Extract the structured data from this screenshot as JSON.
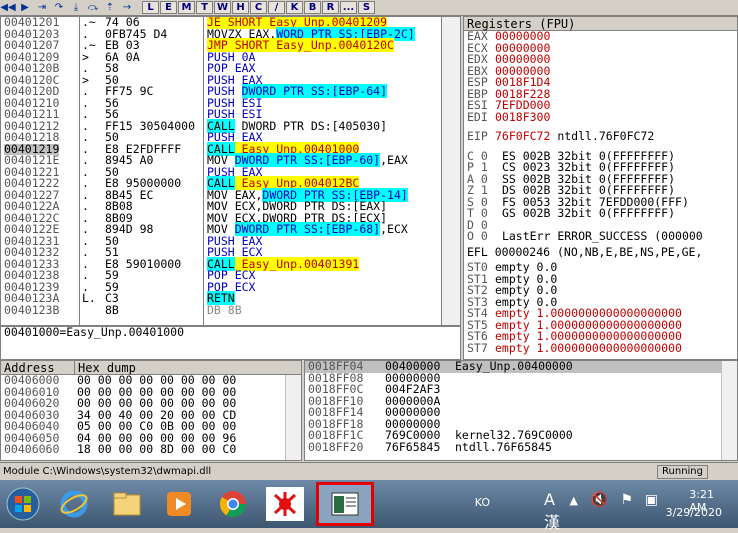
{
  "toolbar": {
    "letters": [
      "L",
      "E",
      "M",
      "T",
      "W",
      "H",
      "C",
      "/",
      "K",
      "B",
      "R",
      "...",
      "S"
    ],
    "icons": [
      "rewind-icon",
      "play-icon",
      "step-into-icon",
      "step-over-icon",
      "trace-into-icon",
      "trace-over-icon",
      "execute-till-return-icon",
      "goto-icon"
    ]
  },
  "cpu": {
    "rows": [
      {
        "addr": "00401201",
        "mark": ".~",
        "hex": "74 06",
        "dis": [
          {
            "t": "JE SHORT Easy_Unp.00401209",
            "c": "jmp"
          }
        ]
      },
      {
        "addr": "00401203",
        "mark": ".",
        "hex": "0FB745 D4",
        "dis": [
          {
            "t": "MOVZX EAX,",
            "c": ""
          },
          {
            "t": "WORD PTR SS:[EBP-2C]",
            "c": "mem"
          }
        ]
      },
      {
        "addr": "00401207",
        "mark": ".~",
        "hex": "EB 03",
        "dis": [
          {
            "t": "JMP SHORT Easy_Unp.0040120C",
            "c": "jmp"
          }
        ]
      },
      {
        "addr": "00401209",
        "mark": ">",
        "hex": "6A 0A",
        "dis": [
          {
            "t": "PUSH 0A",
            "c": "blue"
          }
        ]
      },
      {
        "addr": "0040120B",
        "mark": ".",
        "hex": "58",
        "dis": [
          {
            "t": "POP EAX",
            "c": "blue"
          }
        ]
      },
      {
        "addr": "0040120C",
        "mark": ">",
        "hex": "50",
        "dis": [
          {
            "t": "PUSH EAX",
            "c": "blue"
          }
        ]
      },
      {
        "addr": "0040120D",
        "mark": ".",
        "hex": "FF75 9C",
        "dis": [
          {
            "t": "PUSH ",
            "c": "blue"
          },
          {
            "t": "DWORD PTR SS:[EBP-64]",
            "c": "mem"
          }
        ]
      },
      {
        "addr": "00401210",
        "mark": ".",
        "hex": "56",
        "dis": [
          {
            "t": "PUSH ESI",
            "c": "blue"
          }
        ]
      },
      {
        "addr": "00401211",
        "mark": ".",
        "hex": "56",
        "dis": [
          {
            "t": "PUSH ESI",
            "c": "blue"
          }
        ]
      },
      {
        "addr": "00401212",
        "mark": ".",
        "hex": "FF15 30504000",
        "dis": [
          {
            "t": "CALL",
            "c": "call"
          },
          {
            "t": " DWORD PTR DS:[405030]",
            "c": ""
          }
        ]
      },
      {
        "addr": "00401218",
        "mark": ".",
        "hex": "50",
        "dis": [
          {
            "t": "PUSH EAX",
            "c": "blue"
          }
        ]
      },
      {
        "addr": "00401219",
        "mark": ".",
        "hex": "E8 E2FDFFFF",
        "dis": [
          {
            "t": "CALL",
            "c": "call"
          },
          {
            "t": " Easy_Unp.00401000",
            "c": "jmp"
          }
        ],
        "sel": true
      },
      {
        "addr": "0040121E",
        "mark": ".",
        "hex": "8945 A0",
        "dis": [
          {
            "t": "MOV ",
            "c": ""
          },
          {
            "t": "DWORD PTR SS:[EBP-60]",
            "c": "mem"
          },
          {
            "t": ",EAX",
            "c": ""
          }
        ]
      },
      {
        "addr": "00401221",
        "mark": ".",
        "hex": "50",
        "dis": [
          {
            "t": "PUSH EAX",
            "c": "blue"
          }
        ]
      },
      {
        "addr": "00401222",
        "mark": ".",
        "hex": "E8 95000000",
        "dis": [
          {
            "t": "CALL",
            "c": "call"
          },
          {
            "t": " Easy_Unp.004012BC",
            "c": "jmp"
          }
        ]
      },
      {
        "addr": "00401227",
        "mark": ".",
        "hex": "8B45 EC",
        "dis": [
          {
            "t": "MOV EAX,",
            "c": ""
          },
          {
            "t": "DWORD PTR SS:[EBP-14]",
            "c": "mem"
          }
        ]
      },
      {
        "addr": "0040122A",
        "mark": ".",
        "hex": "8B08",
        "dis": [
          {
            "t": "MOV ECX,DWORD PTR DS:[EAX]",
            "c": ""
          }
        ]
      },
      {
        "addr": "0040122C",
        "mark": ".",
        "hex": "8B09",
        "dis": [
          {
            "t": "MOV ECX,DWORD PTR DS:[ECX]",
            "c": ""
          }
        ]
      },
      {
        "addr": "0040122E",
        "mark": ".",
        "hex": "894D 98",
        "dis": [
          {
            "t": "MOV ",
            "c": ""
          },
          {
            "t": "DWORD PTR SS:[EBP-68]",
            "c": "mem"
          },
          {
            "t": ",ECX",
            "c": ""
          }
        ]
      },
      {
        "addr": "00401231",
        "mark": ".",
        "hex": "50",
        "dis": [
          {
            "t": "PUSH EAX",
            "c": "blue"
          }
        ]
      },
      {
        "addr": "00401232",
        "mark": ".",
        "hex": "51",
        "dis": [
          {
            "t": "PUSH ECX",
            "c": "blue"
          }
        ]
      },
      {
        "addr": "00401233",
        "mark": ".",
        "hex": "E8 59010000",
        "dis": [
          {
            "t": "CALL",
            "c": "call"
          },
          {
            "t": " Easy_Unp.00401391",
            "c": "jmp"
          }
        ]
      },
      {
        "addr": "00401238",
        "mark": ".",
        "hex": "59",
        "dis": [
          {
            "t": "POP ECX",
            "c": "blue"
          }
        ]
      },
      {
        "addr": "00401239",
        "mark": ".",
        "hex": "59",
        "dis": [
          {
            "t": "POP ECX",
            "c": "blue"
          }
        ]
      },
      {
        "addr": "0040123A",
        "mark": "L.",
        "hex": "C3",
        "dis": [
          {
            "t": "RETN",
            "c": "ret"
          }
        ]
      },
      {
        "addr": "0040123B",
        "mark": "",
        "hex": "8B",
        "dis": [
          {
            "t": "DB 8B",
            "c": "gray"
          }
        ]
      }
    ],
    "info": "00401000=Easy_Unp.00401000"
  },
  "registers": {
    "title": "Registers (FPU)",
    "gp": [
      [
        "EAX",
        "00000000"
      ],
      [
        "ECX",
        "00000000"
      ],
      [
        "EDX",
        "00000000"
      ],
      [
        "EBX",
        "00000000"
      ],
      [
        "ESP",
        "0018F1D4"
      ],
      [
        "EBP",
        "0018F228"
      ],
      [
        "ESI",
        "7EFDD000"
      ],
      [
        "EDI",
        "0018F300"
      ]
    ],
    "eip": [
      "EIP",
      "76F0FC72",
      "ntdll.76F0FC72"
    ],
    "flags": [
      [
        "C 0",
        "ES 002B 32bit 0(FFFFFFFF)"
      ],
      [
        "P 1",
        "CS 0023 32bit 0(FFFFFFFF)"
      ],
      [
        "A 0",
        "SS 002B 32bit 0(FFFFFFFF)"
      ],
      [
        "Z 1",
        "DS 002B 32bit 0(FFFFFFFF)"
      ],
      [
        "S 0",
        "FS 0053 32bit 7EFDD000(FFF)"
      ],
      [
        "T 0",
        "GS 002B 32bit 0(FFFFFFFF)"
      ],
      [
        "D 0",
        ""
      ],
      [
        "O 0",
        "LastErr ERROR_SUCCESS (000000"
      ]
    ],
    "efl": "EFL 00000246 (NO,NB,E,BE,NS,PE,GE,",
    "fpu": [
      [
        "ST0",
        "empty 0.0",
        false
      ],
      [
        "ST1",
        "empty 0.0",
        false
      ],
      [
        "ST2",
        "empty 0.0",
        false
      ],
      [
        "ST3",
        "empty 0.0",
        false
      ],
      [
        "ST4",
        "empty 1.0000000000000000000",
        true
      ],
      [
        "ST5",
        "empty 1.0000000000000000000",
        true
      ],
      [
        "ST6",
        "empty 1.0000000000000000000",
        true
      ],
      [
        "ST7",
        "empty 1.0000000000000000000",
        true
      ]
    ]
  },
  "dump": {
    "h_address": "Address",
    "h_hex": "Hex dump",
    "rows": [
      [
        "00406000",
        "00 00 00 00 00 00 00 00"
      ],
      [
        "00406010",
        "00 00 00 00 00 00 00 00"
      ],
      [
        "00406020",
        "00 00 00 00 00 00 00 00"
      ],
      [
        "00406030",
        "34 00 40 00 20 00 00 CD"
      ],
      [
        "00406040",
        "05 00 00 C0 0B 00 00 00"
      ],
      [
        "00406050",
        "04 00 00 00 00 00 00 96"
      ],
      [
        "00406060",
        "18 00 00 00 8D 00 00 C0"
      ]
    ]
  },
  "stack": {
    "rows": [
      [
        "0018FF04",
        "00400000",
        "Easy_Unp.00400000"
      ],
      [
        "0018FF08",
        "00000000",
        ""
      ],
      [
        "0018FF0C",
        "004F2AF3",
        ""
      ],
      [
        "0018FF10",
        "0000000A",
        ""
      ],
      [
        "0018FF14",
        "00000000",
        ""
      ],
      [
        "0018FF18",
        "00000000",
        ""
      ],
      [
        "0018FF1C",
        "769C0000",
        "kernel32.769C0000"
      ],
      [
        "0018FF20",
        "76F65845",
        "ntdll.76F65845"
      ]
    ]
  },
  "status": {
    "module": "Module C:\\Windows\\system32\\dwmapi.dll",
    "state": "Running"
  },
  "taskbar": {
    "lang": "KO",
    "ime": "A 漢",
    "time": "3:21 AM",
    "date": "3/29/2020"
  }
}
